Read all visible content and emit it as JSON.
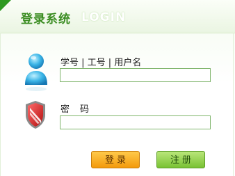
{
  "header": {
    "title_cn": "登录系统",
    "title_en": "LOGIN"
  },
  "form": {
    "username_label": "学号 | 工号 | 用户名",
    "username_value": "",
    "password_label": "密　码",
    "password_value": ""
  },
  "buttons": {
    "login": "登录",
    "register": "注册"
  },
  "icons": {
    "user": "user-avatar-icon",
    "password": "shield-icon"
  },
  "colors": {
    "brand_green": "#3a8c21",
    "input_border": "#7fb56b",
    "login_button": "#f5a623",
    "register_button": "#8acb3f"
  }
}
